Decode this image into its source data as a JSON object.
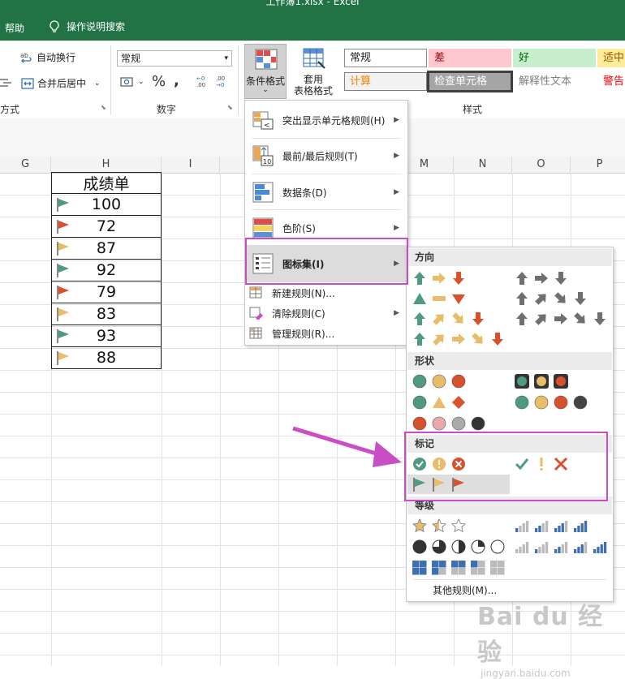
{
  "window": {
    "title": "工作簿1.xlsx  -  Excel"
  },
  "menubar": {
    "help": "帮助",
    "tell_me": "操作说明搜索"
  },
  "ribbon": {
    "alignment": {
      "wrap_text": "自动换行",
      "merge_center": "合并后居中",
      "group_label": "方式"
    },
    "number": {
      "format_value": "常规",
      "group_label": "数字"
    },
    "cond_format": {
      "label": "条件格式"
    },
    "table_format": {
      "line1": "套用",
      "line2": "表格格式"
    },
    "styles": {
      "group_label": "样式",
      "cells": [
        {
          "label": "常规",
          "bg": "#ffffff",
          "fg": "#222222",
          "border": "#8c8c8c"
        },
        {
          "label": "差",
          "bg": "#ffc7ce",
          "fg": "#9c0006",
          "border": "#ffc7ce"
        },
        {
          "label": "好",
          "bg": "#c6efce",
          "fg": "#006100",
          "border": "#c6efce"
        },
        {
          "label": "适中",
          "bg": "#ffeb9c",
          "fg": "#9c5700",
          "border": "#ffeb9c"
        },
        {
          "label": "计算",
          "bg": "#f2f2f2",
          "fg": "#fa7d00",
          "border": "#7f7f7f"
        },
        {
          "label": "检查单元格",
          "bg": "#a5a5a5",
          "fg": "#ffffff",
          "border": "#3f3f3f"
        },
        {
          "label": "解释性文本",
          "bg": "#ffffff",
          "fg": "#7f7f7f",
          "border": "#ffffff"
        },
        {
          "label": "警告",
          "bg": "#ffffff",
          "fg": "#ff0000",
          "border": "#ffffff"
        }
      ]
    }
  },
  "columns": [
    "G",
    "H",
    "I",
    "M",
    "N",
    "O",
    "P"
  ],
  "table": {
    "header": "成绩单",
    "rows": [
      {
        "value": "100",
        "flag": "green"
      },
      {
        "value": "72",
        "flag": "red"
      },
      {
        "value": "87",
        "flag": "yellow"
      },
      {
        "value": "92",
        "flag": "green"
      },
      {
        "value": "79",
        "flag": "red"
      },
      {
        "value": "83",
        "flag": "yellow"
      },
      {
        "value": "93",
        "flag": "green"
      },
      {
        "value": "88",
        "flag": "yellow"
      }
    ]
  },
  "cf_menu": {
    "items": [
      {
        "label": "突出显示单元格规则(H)",
        "icon": "highlight-rules-icon"
      },
      {
        "label": "最前/最后规则(T)",
        "icon": "top-bottom-icon"
      },
      {
        "label": "数据条(D)",
        "icon": "databar-icon"
      },
      {
        "label": "色阶(S)",
        "icon": "colorscale-icon"
      },
      {
        "label": "图标集(I)",
        "icon": "iconset-icon"
      }
    ],
    "new_rule": "新建规则(N)...",
    "clear_rules": "清除规则(C)",
    "manage_rules": "管理规则(R)..."
  },
  "submenu": {
    "sections": {
      "directional": "方向",
      "shapes": "形状",
      "indicators": "标记",
      "ratings": "等级"
    },
    "more_rules": "其他规则(M)..."
  },
  "colors": {
    "excel_green": "#217346",
    "highlight": "#c94ec6",
    "icon_green": "#4f9a82",
    "icon_yellow": "#e9bc6a",
    "icon_red": "#d9512c",
    "icon_gray": "#6f6f6f",
    "icon_blue": "#3d6fb1"
  },
  "watermark": {
    "text": "Bai du 经验",
    "subtext": "jingyan.baidu.com"
  }
}
